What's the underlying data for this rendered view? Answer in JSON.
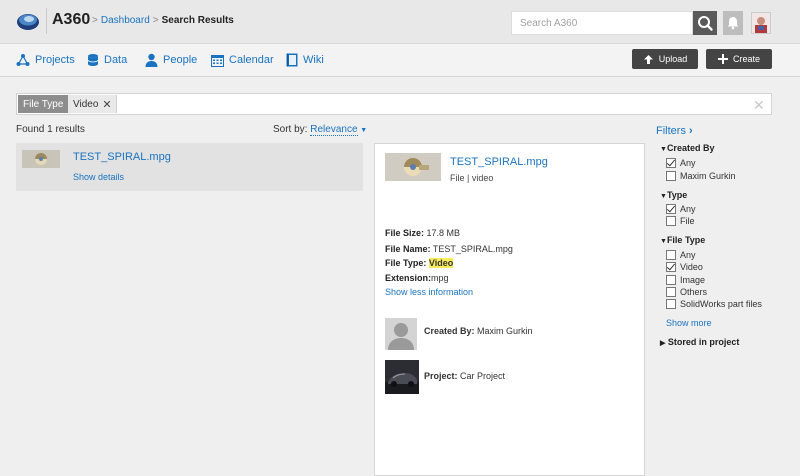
{
  "header": {
    "app_title": "A360",
    "breadcrumb": {
      "home": "Dashboard",
      "current": "Search Results"
    },
    "search_placeholder": "Search A360"
  },
  "nav": {
    "items": [
      {
        "label": "Projects",
        "icon": "projects-icon"
      },
      {
        "label": "Data",
        "icon": "database-icon"
      },
      {
        "label": "People",
        "icon": "person-icon"
      },
      {
        "label": "Calendar",
        "icon": "calendar-icon"
      },
      {
        "label": "Wiki",
        "icon": "book-icon"
      }
    ],
    "upload_label": "Upload",
    "create_label": "Create"
  },
  "filter_bar": {
    "key": "File Type",
    "value": "Video"
  },
  "results": {
    "found_text": "Found 1 results",
    "sort_label": "Sort by:",
    "sort_value": "Relevance",
    "items": [
      {
        "name": "TEST_SPIRAL.mpg",
        "details_link": "Show details"
      }
    ]
  },
  "detail": {
    "name": "TEST_SPIRAL.mpg",
    "type_line": "File | video",
    "props": {
      "size_label": "File Size:",
      "size_value": "17.8 MB",
      "name_label": "File Name:",
      "name_value": "TEST_SPIRAL.mpg",
      "type_label": "File Type:",
      "type_value": "Video",
      "ext_label": "Extension:",
      "ext_value": "mpg"
    },
    "less_info": "Show less information",
    "created_by_label": "Created By:",
    "created_by_value": "Maxim Gurkin",
    "project_label": "Project:",
    "project_value": "Car Project"
  },
  "filters": {
    "title": "Filters",
    "created_by": {
      "title": "Created By",
      "options": [
        {
          "label": "Any",
          "checked": true
        },
        {
          "label": "Maxim Gurkin",
          "checked": false
        }
      ]
    },
    "type": {
      "title": "Type",
      "options": [
        {
          "label": "Any",
          "checked": true
        },
        {
          "label": "File",
          "checked": false
        }
      ]
    },
    "file_type": {
      "title": "File Type",
      "options": [
        {
          "label": "Any",
          "checked": false
        },
        {
          "label": "Video",
          "checked": true
        },
        {
          "label": "Image",
          "checked": false
        },
        {
          "label": "Others",
          "checked": false
        },
        {
          "label": "SolidWorks part files",
          "checked": false
        }
      ]
    },
    "show_more": "Show more",
    "stored_in_project": "Stored in project"
  },
  "colors": {
    "link": "#1a73c0",
    "highlight": "#f7ec5a",
    "button_dark": "#444444"
  }
}
